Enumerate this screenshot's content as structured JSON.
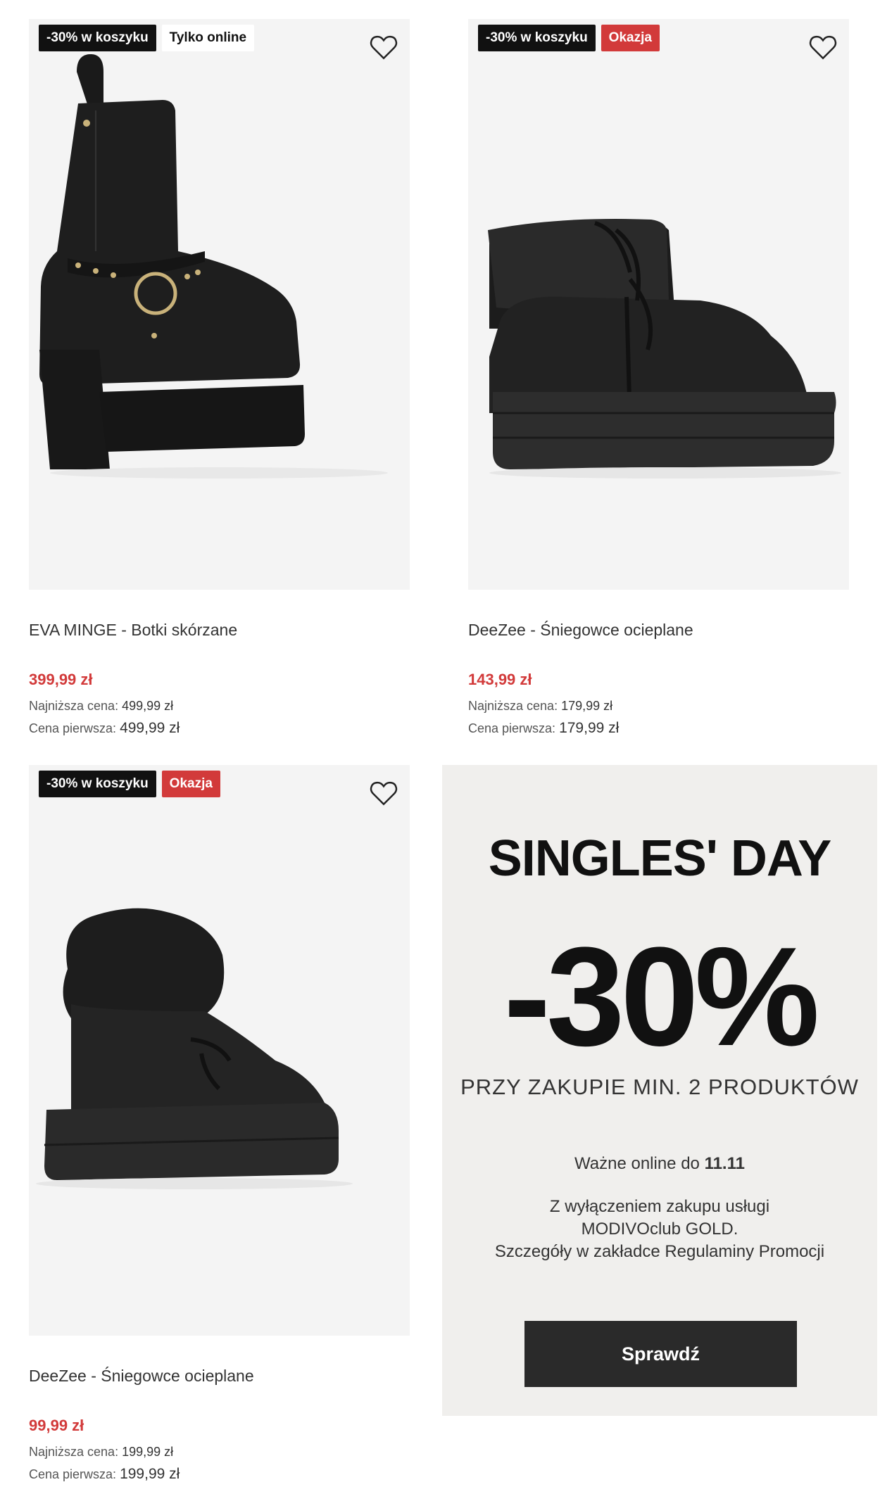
{
  "products": [
    {
      "badges": [
        "-30% w koszyku",
        "Tylko online"
      ],
      "title": "EVA MINGE - Botki skórzane",
      "price": "399,99 zł",
      "lowest_label": "Najniższa cena:",
      "lowest_value": "499,99 zł",
      "first_label": "Cena pierwsza:",
      "first_value": "499,99 zł"
    },
    {
      "badges": [
        "-30% w koszyku",
        "Okazja"
      ],
      "title": "DeeZee - Śniegowce ocieplane",
      "price": "143,99 zł",
      "lowest_label": "Najniższa cena:",
      "lowest_value": "179,99 zł",
      "first_label": "Cena pierwsza:",
      "first_value": "179,99 zł"
    },
    {
      "badges": [
        "-30% w koszyku",
        "Okazja"
      ],
      "title": "DeeZee - Śniegowce ocieplane",
      "price": "99,99 zł",
      "lowest_label": "Najniższa cena:",
      "lowest_value": "199,99 zł",
      "first_label": "Cena pierwsza:",
      "first_value": "199,99 zł"
    }
  ],
  "promo": {
    "headline": "SINGLES' DAY",
    "discount": "-30%",
    "condition": "PRZY ZAKUPIE MIN. 2 PRODUKTÓW",
    "valid_prefix": "Ważne online do",
    "valid_date": "11.11",
    "note_line1": "Z wyłączeniem zakupu usługi",
    "note_line2": "MODIVOclub GOLD.",
    "note_line3": "Szczegóły w zakładce Regulaminy Promocji",
    "button_label": "Sprawdź"
  },
  "colors": {
    "sale_red": "#d23a3a",
    "badge_black": "#111111",
    "image_bg": "#f4f4f4",
    "promo_bg": "#f0efed"
  },
  "icons": {
    "favorite": "heart-outline-icon"
  }
}
